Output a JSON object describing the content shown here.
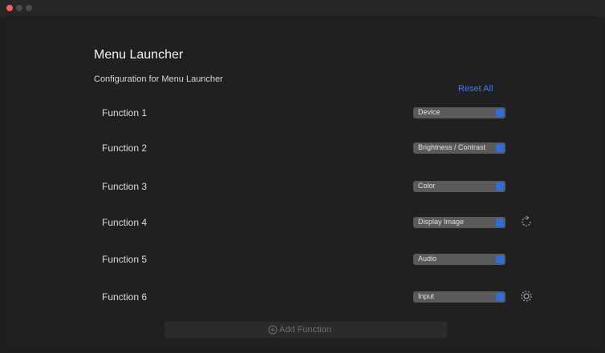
{
  "app": {
    "title": "Menu Launcher",
    "subtitle": "Configuration for Menu Launcher",
    "reset_all_label": "Reset All"
  },
  "functions": [
    {
      "label": "Function 1",
      "value": "Device",
      "icon": null
    },
    {
      "label": "Function 2",
      "value": "Brightness / Contrast",
      "icon": null
    },
    {
      "label": "Function 3",
      "value": "Color",
      "icon": null
    },
    {
      "label": "Function 4",
      "value": "Display Image",
      "icon": "refresh-icon"
    },
    {
      "label": "Function 5",
      "value": "Audio",
      "icon": null
    },
    {
      "label": "Function 6",
      "value": "Input",
      "icon": "settings-icon"
    }
  ],
  "footer": {
    "add_function_label": "Add Function"
  },
  "colors": {
    "accent": "#2f6ee0",
    "link": "#3d7df0",
    "background": "#202020"
  }
}
